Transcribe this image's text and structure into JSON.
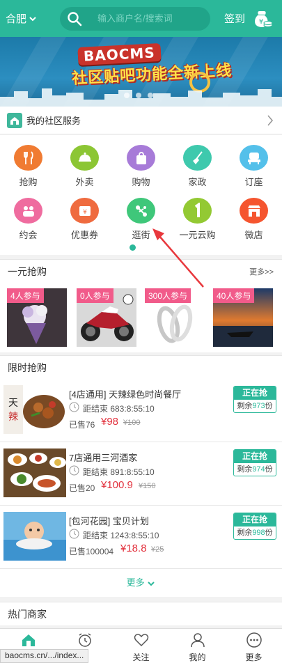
{
  "header": {
    "city": "合肥",
    "search_placeholder": "输入商户名/搜索词",
    "signin": "签到"
  },
  "banner": {
    "logo_text": "BAOCMS",
    "slogan": "社区贴吧功能全新上线"
  },
  "community": {
    "title": "我的社区服务"
  },
  "services": [
    {
      "label": "抢购",
      "icon": "fork-knife-icon",
      "color": "#f07b32"
    },
    {
      "label": "外卖",
      "icon": "takeout-icon",
      "color": "#8cc634"
    },
    {
      "label": "购物",
      "icon": "shopping-bag-icon",
      "color": "#a77bd8"
    },
    {
      "label": "家政",
      "icon": "broom-icon",
      "color": "#3ec9ad"
    },
    {
      "label": "订座",
      "icon": "seat-icon",
      "color": "#54c0ea"
    },
    {
      "label": "约会",
      "icon": "dating-icon",
      "color": "#ef6c9f"
    },
    {
      "label": "优惠券",
      "icon": "coupon-icon",
      "color": "#ef6b3f"
    },
    {
      "label": "逛街",
      "icon": "stroll-icon",
      "color": "#3fc77a"
    },
    {
      "label": "一元云购",
      "icon": "one-yuan-icon",
      "color": "#93c933"
    },
    {
      "label": "微店",
      "icon": "shop-icon",
      "color": "#f5552f"
    }
  ],
  "yiyuan": {
    "title": "一元抢购",
    "more": "更多>>",
    "items": [
      {
        "badge": "4人参与",
        "icon": "flower-bouquet-icon"
      },
      {
        "badge": "0人参与",
        "icon": "motorcycle-icon"
      },
      {
        "badge": "300人参与",
        "icon": "rings-icon"
      },
      {
        "badge": "40人参与",
        "icon": "sunset-boat-icon"
      }
    ]
  },
  "flash": {
    "title": "限时抢购",
    "items": [
      {
        "name": "[4店通用] 天辣绿色时尚餐厅",
        "timer": "距结束 683:8:55:10",
        "sold": "已售76",
        "price": "¥98",
        "orig": "¥100",
        "status": "正在抢",
        "remain_prefix": "剩余",
        "remain": "973",
        "remain_suffix": "份"
      },
      {
        "name": "7店通用三河酒家",
        "timer": "距结束 891:8:55:10",
        "sold": "已售20",
        "price": "¥100.9",
        "orig": "¥150",
        "status": "正在抢",
        "remain_prefix": "剩余",
        "remain": "974",
        "remain_suffix": "份"
      },
      {
        "name": "[包河花园] 宝贝计划",
        "timer": "距结束 1243:8:55:10",
        "sold": "已售100004",
        "price": "¥18.8",
        "orig": "¥25",
        "status": "正在抢",
        "remain_prefix": "剩余",
        "remain": "998",
        "remain_suffix": "份"
      }
    ],
    "more": "更多"
  },
  "hot": {
    "title": "热门商家"
  },
  "tabbar": [
    {
      "label": "",
      "icon": "home-icon"
    },
    {
      "label": "",
      "icon": "alarm-clock-icon"
    },
    {
      "label": "关注",
      "icon": "heart-icon"
    },
    {
      "label": "我的",
      "icon": "user-icon"
    },
    {
      "label": "更多",
      "icon": "more-dots-icon"
    }
  ],
  "status_url": "baocms.cn/.../index..."
}
